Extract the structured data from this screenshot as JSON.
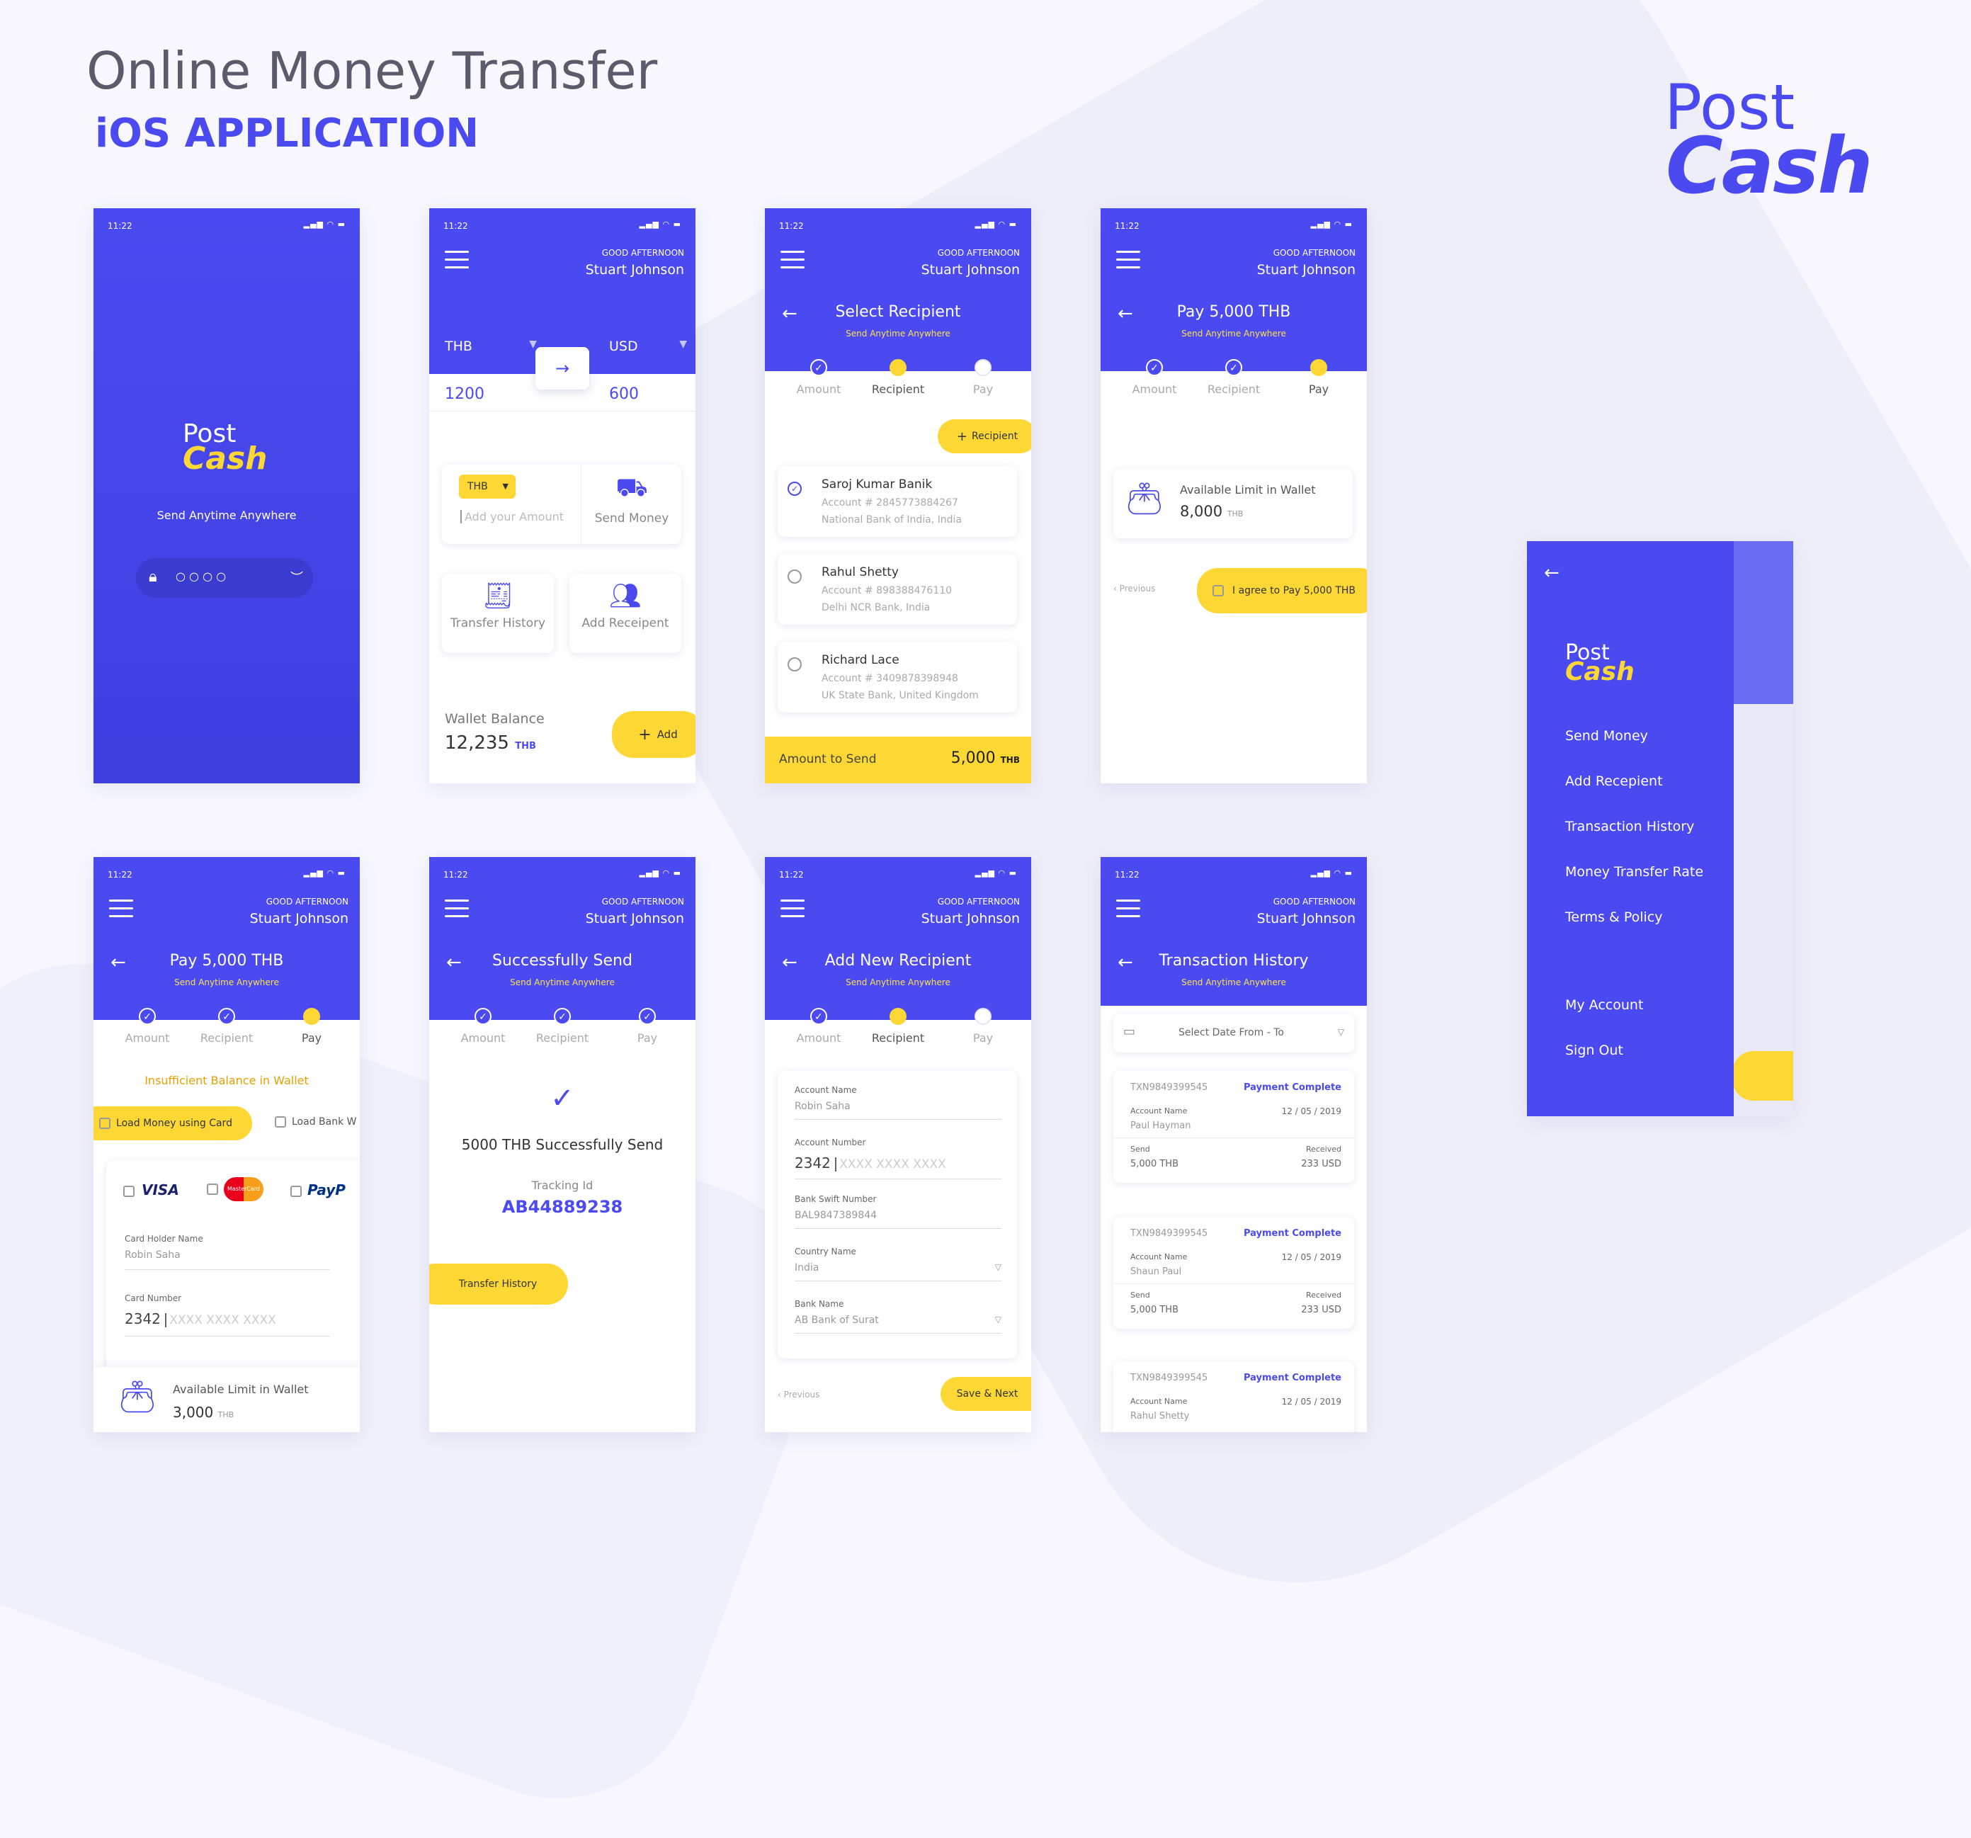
{
  "header": {
    "title": "Online Money Transfer",
    "subtitle": "iOS APPLICATION"
  },
  "brand": {
    "post": "Post",
    "cash": "Cash"
  },
  "colors": {
    "primary": "#4a4af0",
    "accent": "#fdd835"
  },
  "status_time": "11:22",
  "greeting": "GOOD AFTERNOON",
  "user": "Stuart Johnson",
  "tagline": "Send Anytime Anywhere",
  "steps": [
    "Amount",
    "Recipient",
    "Pay"
  ],
  "s1": {
    "pin_dots": "○   ○   ○   ○"
  },
  "s2": {
    "from_currency": "THB",
    "to_currency": "USD",
    "from_amount": "1200",
    "to_amount": "600",
    "currency_chip": "THB",
    "amount_placeholder": "Add your Amount",
    "send_money": "Send Money",
    "transfer_history": "Transfer History",
    "add_recipient": "Add Receipent",
    "wallet_label": "Wallet Balance",
    "wallet_value": "12,235",
    "wallet_unit": "THB",
    "add_btn": "Add"
  },
  "s3": {
    "title": "Select Recipient",
    "recipient_btn": "Recipient",
    "recipients": [
      {
        "name": "Saroj Kumar Banik",
        "account": "Account # 2845773884267",
        "bank": "National Bank of India, India"
      },
      {
        "name": "Rahul Shetty",
        "account": "Account # 898388476110",
        "bank": "Delhi NCR Bank, India"
      },
      {
        "name": "Richard Lace",
        "account": "Account # 3409878398948",
        "bank": "UK State Bank, United Kingdom"
      }
    ],
    "amount_label": "Amount to Send",
    "amount_value": "5,000",
    "amount_unit": "THB"
  },
  "s4": {
    "title": "Pay 5,000 THB",
    "limit_label": "Available Limit in Wallet",
    "limit_value": "8,000",
    "limit_unit": "THB",
    "previous": "Previous",
    "agree": "I agree to Pay 5,000 THB"
  },
  "s5": {
    "title": "Pay 5,000 THB",
    "insufficient": "Insufficient Balance in Wallet",
    "load_card": "Load Money using Card",
    "load_bank": "Load Bank W",
    "visa": "VISA",
    "mastercard": "MasterCard",
    "paypal": "PayP",
    "holder_label": "Card Holder Name",
    "holder_value": "Robin Saha",
    "number_label": "Card Number",
    "number_first": "2342",
    "number_mask": "XXXX   XXXX   XXXX",
    "limit_label": "Available Limit in Wallet",
    "limit_value": "3,000",
    "limit_unit": "THB"
  },
  "s6": {
    "title": "Successfully Send",
    "message": "5000 THB Successfully Send",
    "tracking_label": "Tracking Id",
    "tracking_id": "AB44889238",
    "history_btn": "Transfer History"
  },
  "s7": {
    "title": "Add New Recipient",
    "account_name_label": "Account Name",
    "account_name_value": "Robin Saha",
    "account_number_label": "Account Number",
    "account_number_first": "2342",
    "account_number_mask": "XXXX   XXXX   XXXX",
    "swift_label": "Bank Swift Number",
    "swift_value": "BAL9847389844",
    "country_label": "Country Name",
    "country_value": "India",
    "bank_label": "Bank Name",
    "bank_value": "AB Bank of Surat",
    "previous": "Previous",
    "save_next": "Save & Next"
  },
  "s8": {
    "title": "Transaction History",
    "date_filter": "Select Date From - To",
    "transactions": [
      {
        "id": "TXN9849399545",
        "status": "Payment Complete",
        "name_label": "Account Name",
        "name": "Paul Hayman",
        "date": "12 / 05 / 2019",
        "send_label": "Send",
        "send": "5,000 THB",
        "recv_label": "Received",
        "recv": "233 USD"
      },
      {
        "id": "TXN9849399545",
        "status": "Payment Complete",
        "name_label": "Account Name",
        "name": "Shaun Paul",
        "date": "12 / 05 / 2019",
        "send_label": "Send",
        "send": "5,000 THB",
        "recv_label": "Received",
        "recv": "233 USD"
      },
      {
        "id": "TXN9849399545",
        "status": "Payment Complete",
        "name_label": "Account Name",
        "name": "Rahul Shetty",
        "date": "12 / 05 / 2019"
      }
    ]
  },
  "s9": {
    "menu": [
      "Send Money",
      "Add Recepient",
      "Transaction History",
      "Money Transfer Rate",
      "Terms & Policy"
    ],
    "account": [
      "My Account",
      "Sign Out"
    ]
  }
}
